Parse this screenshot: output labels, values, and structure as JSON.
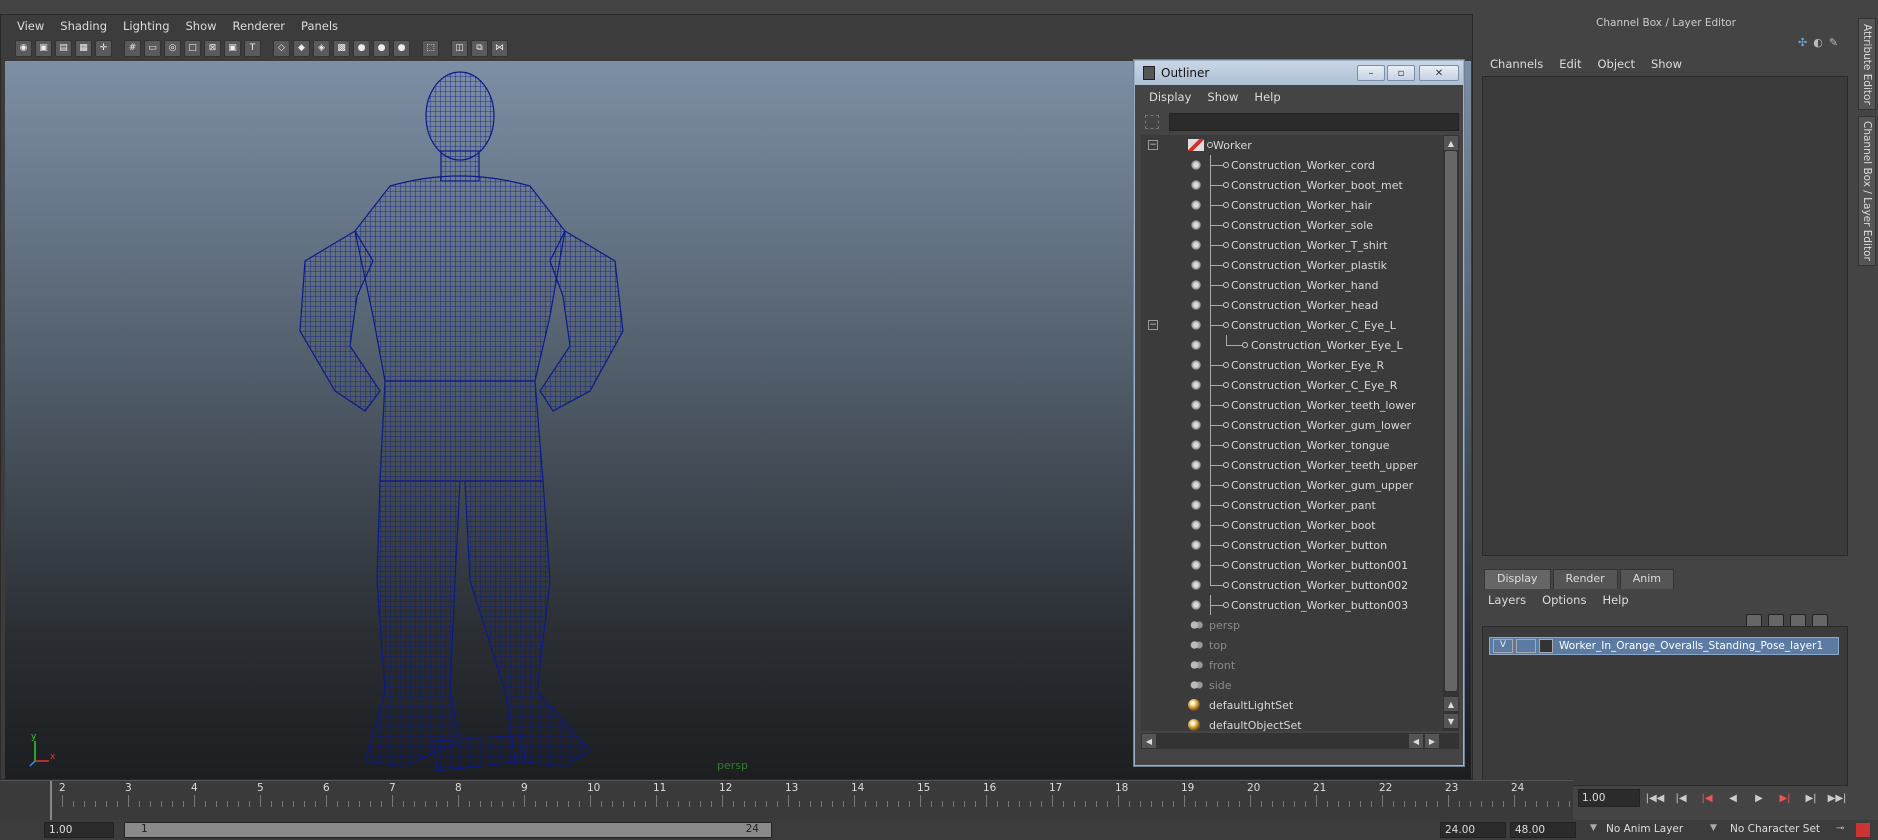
{
  "viewport_panel": {
    "menu": [
      "View",
      "Shading",
      "Lighting",
      "Show",
      "Renderer",
      "Panels"
    ],
    "camera_label": "persp"
  },
  "outliner": {
    "title": "Outliner",
    "menu": [
      "Display",
      "Show",
      "Help"
    ],
    "items": [
      {
        "label": "Worker",
        "type": "group",
        "depth": 0,
        "expander": "−"
      },
      {
        "label": "Construction_Worker_cord",
        "type": "mesh",
        "depth": 1
      },
      {
        "label": "Construction_Worker_boot_met",
        "type": "mesh",
        "depth": 1
      },
      {
        "label": "Construction_Worker_hair",
        "type": "mesh",
        "depth": 1
      },
      {
        "label": "Construction_Worker_sole",
        "type": "mesh",
        "depth": 1
      },
      {
        "label": "Construction_Worker_T_shirt",
        "type": "mesh",
        "depth": 1
      },
      {
        "label": "Construction_Worker_plastik",
        "type": "mesh",
        "depth": 1
      },
      {
        "label": "Construction_Worker_hand",
        "type": "mesh",
        "depth": 1
      },
      {
        "label": "Construction_Worker_head",
        "type": "mesh",
        "depth": 1
      },
      {
        "label": "Construction_Worker_C_Eye_L",
        "type": "mesh",
        "depth": 1,
        "expander": "−"
      },
      {
        "label": "Construction_Worker_Eye_L",
        "type": "mesh",
        "depth": 2
      },
      {
        "label": "Construction_Worker_Eye_R",
        "type": "mesh",
        "depth": 1
      },
      {
        "label": "Construction_Worker_C_Eye_R",
        "type": "mesh",
        "depth": 1
      },
      {
        "label": "Construction_Worker_teeth_lower",
        "type": "mesh",
        "depth": 1
      },
      {
        "label": "Construction_Worker_gum_lower",
        "type": "mesh",
        "depth": 1
      },
      {
        "label": "Construction_Worker_tongue",
        "type": "mesh",
        "depth": 1
      },
      {
        "label": "Construction_Worker_teeth_upper",
        "type": "mesh",
        "depth": 1
      },
      {
        "label": "Construction_Worker_gum_upper",
        "type": "mesh",
        "depth": 1
      },
      {
        "label": "Construction_Worker_pant",
        "type": "mesh",
        "depth": 1
      },
      {
        "label": "Construction_Worker_boot",
        "type": "mesh",
        "depth": 1
      },
      {
        "label": "Construction_Worker_button",
        "type": "mesh",
        "depth": 1
      },
      {
        "label": "Construction_Worker_button001",
        "type": "mesh",
        "depth": 1
      },
      {
        "label": "Construction_Worker_button002",
        "type": "mesh",
        "depth": 1
      },
      {
        "label": "Construction_Worker_button003",
        "type": "mesh",
        "depth": 1
      },
      {
        "label": "persp",
        "type": "camera",
        "depth": 0,
        "dim": true
      },
      {
        "label": "top",
        "type": "camera",
        "depth": 0,
        "dim": true
      },
      {
        "label": "front",
        "type": "camera",
        "depth": 0,
        "dim": true
      },
      {
        "label": "side",
        "type": "camera",
        "depth": 0,
        "dim": true
      },
      {
        "label": "defaultLightSet",
        "type": "set",
        "depth": 0
      },
      {
        "label": "defaultObjectSet",
        "type": "set",
        "depth": 0
      }
    ]
  },
  "channel_box": {
    "title": "Channel Box / Layer Editor",
    "menu": [
      "Channels",
      "Edit",
      "Object",
      "Show"
    ]
  },
  "side_tabs": [
    "Attribute Editor",
    "Channel Box / Layer Editor"
  ],
  "layer_editor": {
    "tabs": [
      "Display",
      "Render",
      "Anim"
    ],
    "active_tab": "Display",
    "menu": [
      "Layers",
      "Options",
      "Help"
    ],
    "layer": {
      "visible": "V",
      "name": "Worker_In_Orange_Overalls_Standing_Pose_layer1"
    }
  },
  "timeline": {
    "ticks": [
      "2",
      "3",
      "4",
      "5",
      "6",
      "7",
      "8",
      "9",
      "10",
      "11",
      "12",
      "13",
      "14",
      "15",
      "16",
      "17",
      "18",
      "19",
      "20",
      "21",
      "22",
      "23",
      "24"
    ],
    "current_frame": "1.00"
  },
  "range_bar": {
    "start_time": "1.00",
    "range_start": "1",
    "range_end": "24",
    "end_time": "24.00",
    "anim_end": "48.00",
    "anim_layer": "No Anim Layer",
    "character_set": "No Character Set"
  },
  "colors": {
    "wireframe": "#0c1a8a",
    "selection_title": "#b8c8dc",
    "layer_highlight": "#5b7ba3"
  }
}
